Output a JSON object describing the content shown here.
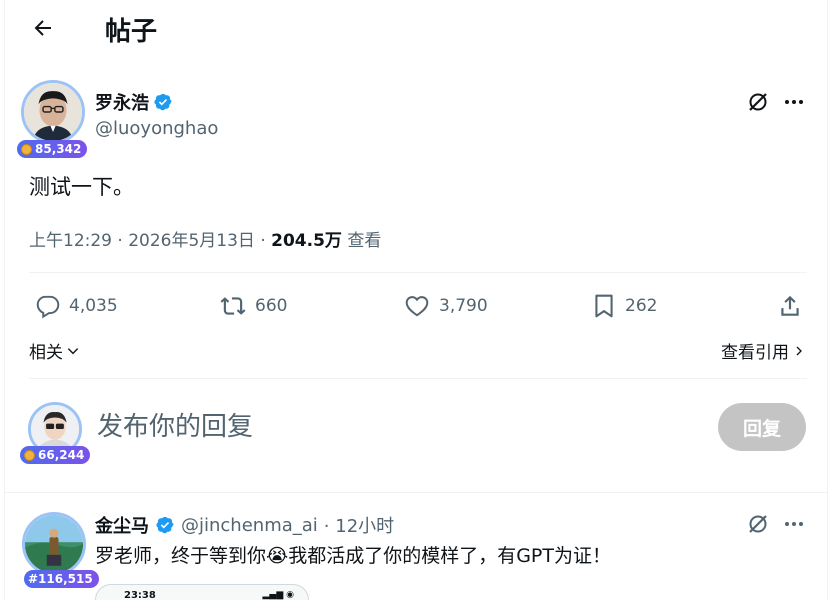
{
  "header": {
    "title": "帖子"
  },
  "post": {
    "display_name": "罗永浩",
    "handle": "@luoyonghao",
    "badge_count": "85,342",
    "text": "测试一下。",
    "time": "上午12:29 · 2026年5月13日 · ",
    "views": "204.5万",
    "views_label": " 查看",
    "actions": {
      "replies": "4,035",
      "reposts": "660",
      "likes": "3,790",
      "bookmarks": "262"
    },
    "related_label": "相关",
    "quotes_label": "查看引用"
  },
  "composer": {
    "badge_count": "66,244",
    "placeholder": "发布你的回复",
    "reply_button": "回复"
  },
  "reply": {
    "display_name": "金尘马",
    "handle": "@jinchenma_ai",
    "time": "· 12小时",
    "badge_count": "#116,515",
    "text": "罗老师，终于等到你😭我都活成了你的模样了，有GPT为证！",
    "media_time": "23:38"
  },
  "colors": {
    "verified": "#1d9bf0",
    "badge_gradient_start": "#4e6cf0",
    "badge_gradient_end": "#7d52e8",
    "reply_button_disabled": "#c4c4c4"
  },
  "icons": {
    "back": "arrow-left-icon",
    "grok": "grok-icon",
    "more": "more-dots-icon",
    "reply": "comment-icon",
    "repost": "repost-icon",
    "like": "heart-icon",
    "bookmark": "bookmark-icon",
    "share": "share-icon"
  }
}
